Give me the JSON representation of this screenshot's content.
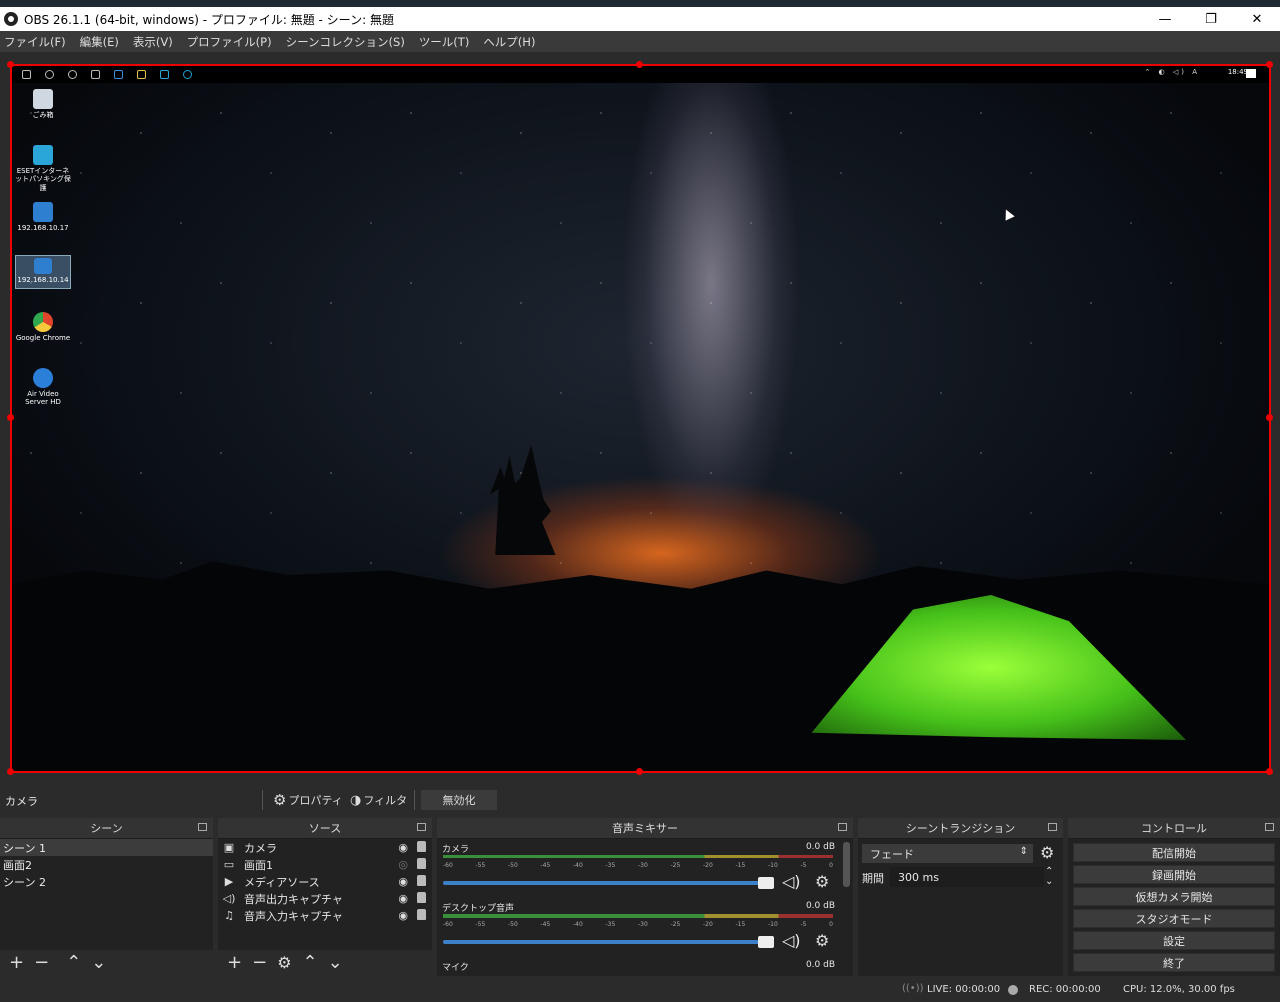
{
  "window": {
    "title": "OBS 26.1.1 (64-bit, windows) - プロファイル: 無題 - シーン: 無題",
    "min_glyph": "—",
    "max_glyph": "❐",
    "close_glyph": "✕"
  },
  "menu": [
    "ファイル(F)",
    "編集(E)",
    "表示(V)",
    "プロファイル(P)",
    "シーンコレクション(S)",
    "ツール(T)",
    "ヘルプ(H)"
  ],
  "desktop": {
    "clock": "18:49",
    "tray": "⌃ ◐ ◁) A",
    "icons": [
      {
        "label": "ごみ箱",
        "color": "#cfd8e0"
      },
      {
        "label": "ESETインターネットパソキング保護",
        "color": "#2aa6d8"
      },
      {
        "label": "192.168.10.17",
        "color": "#2f7fd0"
      },
      {
        "label": "192.168.10.14",
        "color": "#2f7fd0"
      },
      {
        "label": "Google Chrome",
        "color": "#e0452b"
      },
      {
        "label": "Air Video Server HD",
        "color": "#2a7fd8"
      }
    ]
  },
  "source_toolbar": {
    "selected_source": "カメラ",
    "properties": "プロパティ",
    "filters": "フィルタ",
    "disable": "無効化"
  },
  "scenes": {
    "title": "シーン",
    "items": [
      "シーン 1",
      "画面2",
      "シーン 2"
    ]
  },
  "sources": {
    "title": "ソース",
    "items": [
      {
        "label": "カメラ",
        "icon": "camera-icon",
        "glyph": "▣",
        "visible": true
      },
      {
        "label": "画面1",
        "icon": "monitor-icon",
        "glyph": "▭",
        "visible": false
      },
      {
        "label": "メディアソース",
        "icon": "play-icon",
        "glyph": "▶",
        "visible": true
      },
      {
        "label": "音声出力キャプチャ",
        "icon": "speaker-icon",
        "glyph": "◁)",
        "visible": true
      },
      {
        "label": "音声入力キャプチャ",
        "icon": "microphone-icon",
        "glyph": "♫",
        "visible": true
      }
    ]
  },
  "mixer": {
    "title": "音声ミキサー",
    "ticks": [
      "-60",
      "-55",
      "-50",
      "-45",
      "-40",
      "-35",
      "-30",
      "-25",
      "-20",
      "-15",
      "-10",
      "-5",
      "0"
    ],
    "channels": [
      {
        "name": "カメラ",
        "db": "0.0 dB"
      },
      {
        "name": "デスクトップ音声",
        "db": "0.0 dB"
      },
      {
        "name": "マイク",
        "db": "0.0 dB"
      }
    ]
  },
  "transitions": {
    "title": "シーントランジション",
    "selected": "フェード",
    "duration_label": "期間",
    "duration_value": "300 ms"
  },
  "controls": {
    "title": "コントロール",
    "buttons": [
      "配信開始",
      "録画開始",
      "仮想カメラ開始",
      "スタジオモード",
      "設定",
      "終了"
    ]
  },
  "status": {
    "live": "LIVE: 00:00:00",
    "rec": "REC: 00:00:00",
    "cpu": "CPU: 12.0%, 30.00 fps"
  }
}
